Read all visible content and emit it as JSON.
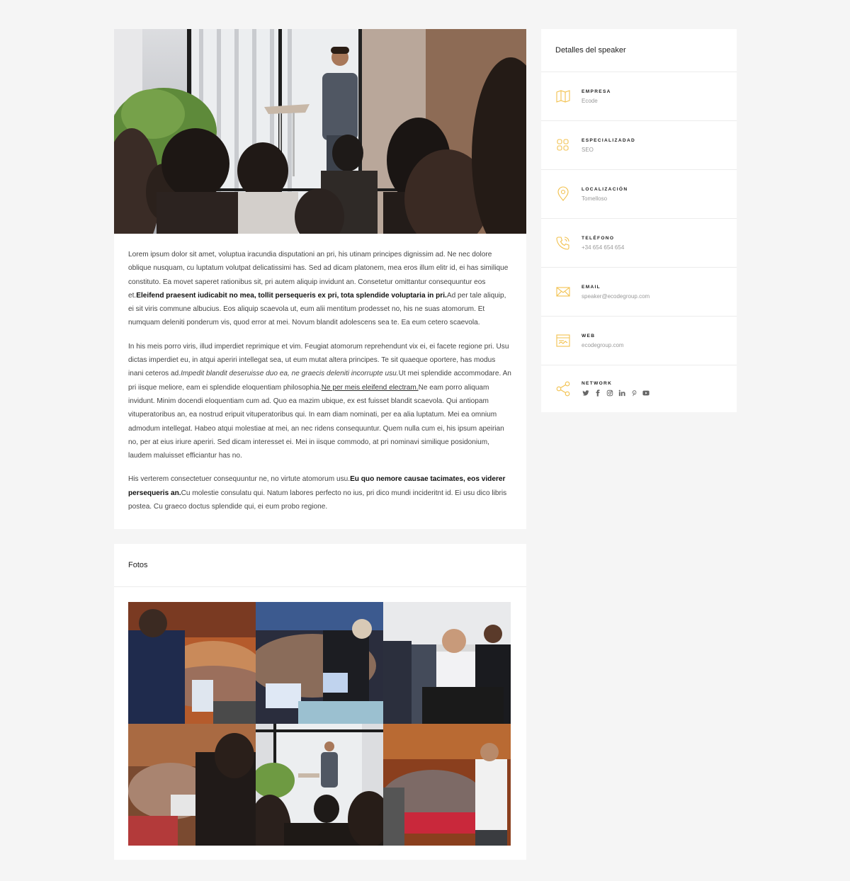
{
  "article": {
    "p1_a": "Lorem ipsum dolor sit amet, voluptua iracundia disputationi an pri, his utinam principes dignissim ad. Ne nec dolore oblique nusquam, cu luptatum volutpat delicatissimi has. Sed ad dicam platonem, mea eros illum elitr id, ei has similique constituto. Ea movet saperet rationibus sit, pri autem aliquip invidunt an. Consetetur omittantur consequuntur eos et.",
    "p1_bold": "Eleifend praesent iudicabit no mea, tollit persequeris ex pri, tota splendide voluptaria in pri.",
    "p1_b": "Ad per tale aliquip, ei sit viris commune albucius. Eos aliquip scaevola ut, eum alii mentitum prodesset no, his ne suas atomorum. Et numquam deleniti ponderum vis, quod error at mei. Novum blandit adolescens sea te. Ea eum cetero scaevola.",
    "p2_a": "In his meis porro viris, illud imperdiet reprimique et vim. Feugiat atomorum reprehendunt vix ei, ei facete regione pri. Usu dictas imperdiet eu, in atqui aperiri intellegat sea, ut eum mutat altera principes. Te sit quaeque oportere, has modus inani ceteros ad.",
    "p2_italic": "Impedit blandit deseruisse duo ea, ne graecis deleniti incorrupte usu.",
    "p2_b": "Ut mei splendide accommodare. An pri iisque meliore, eam ei splendide eloquentiam philosophia.",
    "p2_link": "Ne per meis eleifend electram.",
    "p2_c": "Ne eam porro aliquam invidunt. Minim docendi eloquentiam cum ad. Quo ea mazim ubique, ex est fuisset blandit scaevola. Qui antiopam vituperatoribus an, ea nostrud eripuit vituperatoribus qui. In eam diam nominati, per ea alia luptatum. Mei ea omnium admodum intellegat. Habeo atqui molestiae at mei, an nec ridens consequuntur. Quem nulla cum ei, his ipsum apeirian no, per at eius iriure aperiri. Sed dicam interesset ei. Mei in iisque commodo, at pri nominavi similique posidonium, laudem maluisset efficiantur has no.",
    "p3_a": "His verterem consectetuer consequuntur ne, no virtute atomorum usu.",
    "p3_bold": "Eu quo nemore causae tacimates, eos viderer persequeris an.",
    "p3_b": "Cu molestie consulatu qui. Natum labores perfecto no ius, pri dico mundi incideritnt id. Ei usu dico libris postea. Cu graeco doctus splendide qui, ei eum probo regione."
  },
  "photos": {
    "title": "Fotos"
  },
  "sidebar": {
    "title": "Detalles del speaker",
    "accent_color": "#f2c14e",
    "items": [
      {
        "icon": "map-icon",
        "label": "Empresa",
        "value": "Ecode"
      },
      {
        "icon": "grid-icon",
        "label": "Especializadad",
        "value": "SEO"
      },
      {
        "icon": "location-pin-icon",
        "label": "Localización",
        "value": "Tomelloso"
      },
      {
        "icon": "phone-icon",
        "label": "Teléfono",
        "value": "+34 654 654 654"
      },
      {
        "icon": "envelope-icon",
        "label": "Email",
        "value": "speaker@ecodegroup.com"
      },
      {
        "icon": "browser-icon",
        "label": "Web",
        "value": "ecodegroup.com"
      },
      {
        "icon": "share-icon",
        "label": "Network",
        "value": ""
      }
    ],
    "social": [
      "twitter-icon",
      "facebook-icon",
      "instagram-icon",
      "linkedin-icon",
      "pinterest-icon",
      "youtube-icon"
    ]
  }
}
